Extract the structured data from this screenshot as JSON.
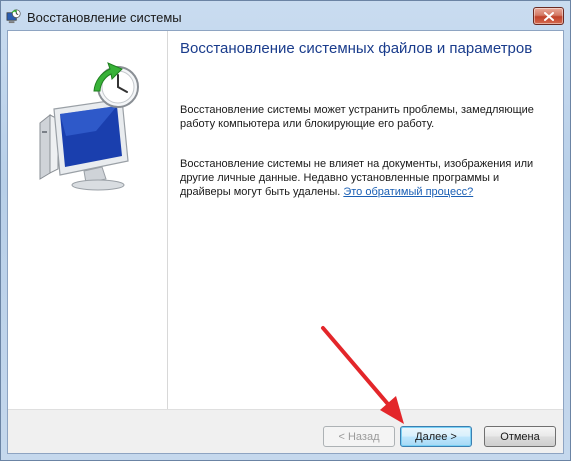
{
  "window": {
    "title": "Восстановление системы",
    "close_symbol": "✕"
  },
  "main": {
    "heading": "Восстановление системных файлов и параметров",
    "paragraph1": "Восстановление системы может устранить проблемы, замедляющие работу компьютера или блокирующие его работу.",
    "paragraph2_text": "Восстановление системы не влияет на документы, изображения или другие личные данные. Недавно установленные программы и драйверы могут быть удалены.",
    "paragraph2_link": "Это обратимый процесс?"
  },
  "footer": {
    "back_label": "< Назад",
    "next_label": "Далее >",
    "cancel_label": "Отмена"
  },
  "icons": {
    "title_icon": "system-restore-icon",
    "illustration": "computer-restore-clock-icon",
    "annotation": "red-arrow"
  },
  "colors": {
    "heading": "#1a3c8c",
    "link": "#1a5fb4",
    "annotation_arrow": "#e3262a",
    "close_button": "#c0412a"
  }
}
